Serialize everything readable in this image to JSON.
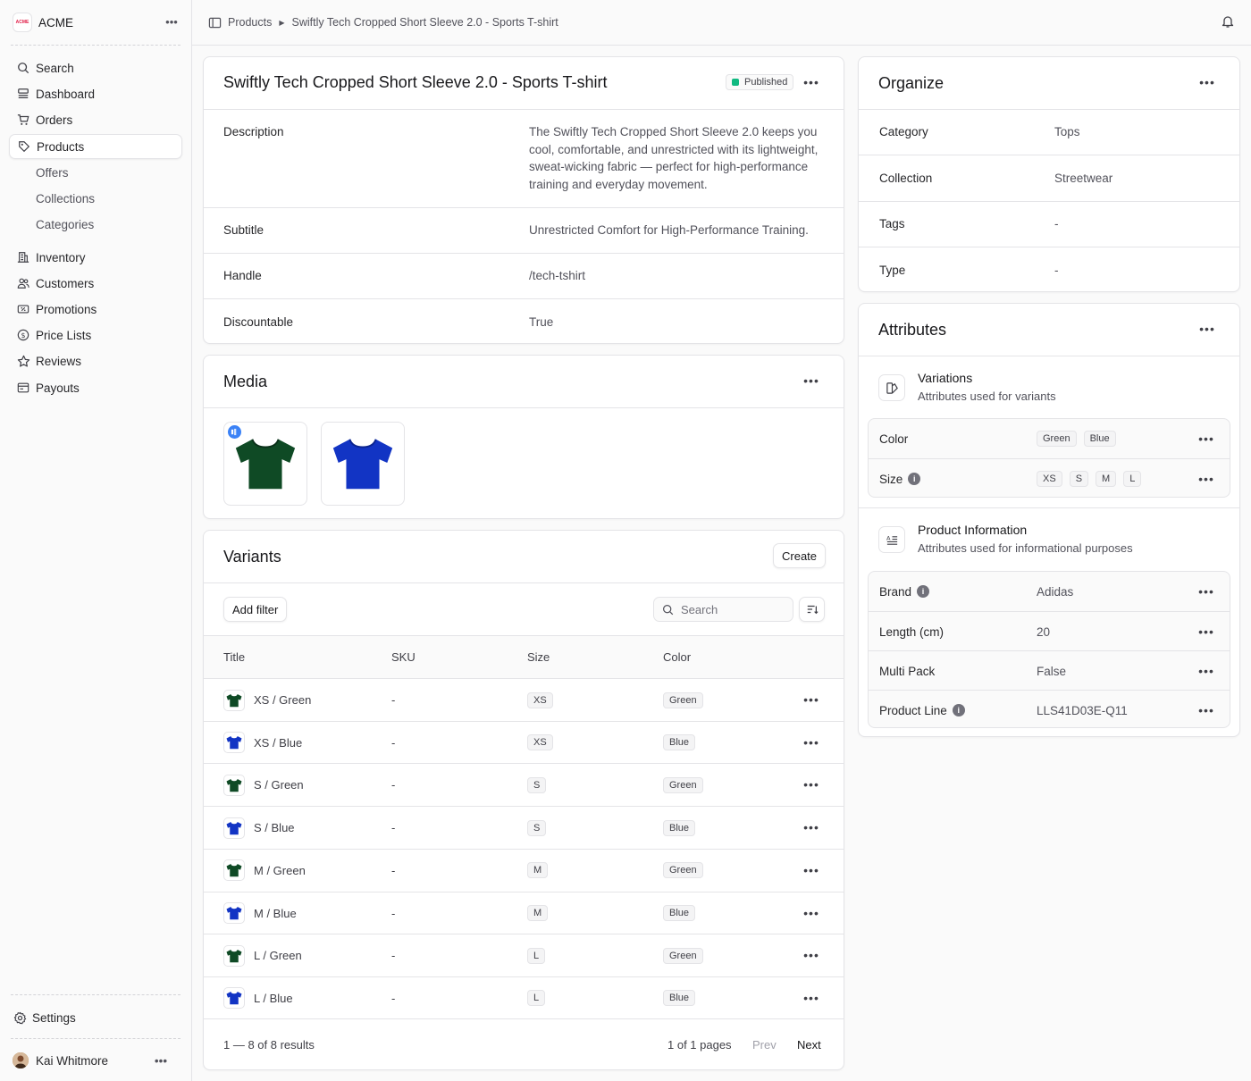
{
  "app": {
    "name": "ACME",
    "logo_text": "ACME"
  },
  "sidebar": {
    "search": "Search",
    "items": [
      {
        "label": "Dashboard",
        "icon": "dashboard-icon"
      },
      {
        "label": "Orders",
        "icon": "cart-icon"
      },
      {
        "label": "Products",
        "icon": "tag-icon"
      },
      {
        "label": "Offers"
      },
      {
        "label": "Collections"
      },
      {
        "label": "Categories"
      },
      {
        "label": "Inventory",
        "icon": "building-icon"
      },
      {
        "label": "Customers",
        "icon": "users-icon"
      },
      {
        "label": "Promotions",
        "icon": "ticket-icon"
      },
      {
        "label": "Price Lists",
        "icon": "dollar-icon"
      },
      {
        "label": "Reviews",
        "icon": "star-icon"
      },
      {
        "label": "Payouts",
        "icon": "receipt-icon"
      }
    ],
    "settings": "Settings",
    "user": "Kai Whitmore"
  },
  "breadcrumb": {
    "root": "Products",
    "current": "Swiftly Tech Cropped Short Sleeve 2.0 - Sports T-shirt"
  },
  "product": {
    "title": "Swiftly Tech Cropped Short Sleeve 2.0 - Sports T-shirt",
    "status": "Published",
    "fields": [
      {
        "label": "Description",
        "value": "The Swiftly Tech Cropped Short Sleeve 2.0 keeps you cool, comfortable, and unrestricted with its lightweight, sweat-wicking fabric — perfect for high-performance training and everyday movement."
      },
      {
        "label": "Subtitle",
        "value": "Unrestricted Comfort for High-Performance Training."
      },
      {
        "label": "Handle",
        "value": "/tech-tshirt"
      },
      {
        "label": "Discountable",
        "value": "True"
      }
    ]
  },
  "media": {
    "title": "Media"
  },
  "variants": {
    "title": "Variants",
    "create": "Create",
    "add_filter": "Add filter",
    "search_placeholder": "Search",
    "columns": [
      "Title",
      "SKU",
      "Size",
      "Color"
    ],
    "rows": [
      {
        "title": "XS / Green",
        "sku": "-",
        "size": "XS",
        "color": "Green"
      },
      {
        "title": "XS / Blue",
        "sku": "-",
        "size": "XS",
        "color": "Blue"
      },
      {
        "title": "S / Green",
        "sku": "-",
        "size": "S",
        "color": "Green"
      },
      {
        "title": "S / Blue",
        "sku": "-",
        "size": "S",
        "color": "Blue"
      },
      {
        "title": "M / Green",
        "sku": "-",
        "size": "M",
        "color": "Green"
      },
      {
        "title": "M / Blue",
        "sku": "-",
        "size": "M",
        "color": "Blue"
      },
      {
        "title": "L / Green",
        "sku": "-",
        "size": "L",
        "color": "Green"
      },
      {
        "title": "L / Blue",
        "sku": "-",
        "size": "L",
        "color": "Blue"
      }
    ],
    "range": "1 — 8 of 8 results",
    "pages": "1 of 1 pages",
    "prev": "Prev",
    "next": "Next"
  },
  "organize": {
    "title": "Organize",
    "fields": [
      {
        "label": "Category",
        "value": "Tops"
      },
      {
        "label": "Collection",
        "value": "Streetwear"
      },
      {
        "label": "Tags",
        "value": "-"
      },
      {
        "label": "Type",
        "value": "-"
      }
    ]
  },
  "attributes": {
    "title": "Attributes",
    "variations": {
      "title": "Variations",
      "subtitle": "Attributes used for variants",
      "color_label": "Color",
      "color_values": [
        "Green",
        "Blue"
      ],
      "size_label": "Size",
      "size_values": [
        "XS",
        "S",
        "M",
        "L"
      ]
    },
    "info": {
      "title": "Product Information",
      "subtitle": "Attributes used for informational purposes",
      "rows": [
        {
          "label": "Brand",
          "value": "Adidas"
        },
        {
          "label": "Length (cm)",
          "value": "20"
        },
        {
          "label": "Multi Pack",
          "value": "False"
        },
        {
          "label": "Product Line",
          "value": "LLS41D03E-Q11"
        }
      ]
    }
  },
  "colors": {
    "green_shirt": "#0f4a25",
    "blue_shirt": "#1234c4",
    "published": "#10b981"
  }
}
